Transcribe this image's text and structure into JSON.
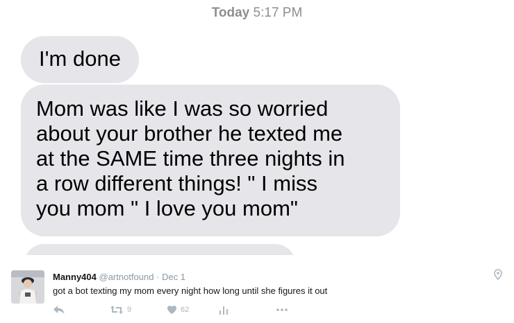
{
  "chat": {
    "timestamp_day": "Today",
    "timestamp_time": "5:17 PM",
    "messages": [
      {
        "text": "I'm done"
      },
      {
        "text": "Mom was like I was so worried\nabout your brother he texted me\nat the SAME time three nights in\na row different things! \" I miss\nyou mom \" I love you mom\""
      }
    ],
    "bubble_color": "#e5e5ea"
  },
  "tweet": {
    "name": "Manny404",
    "handle": "@artnotfound",
    "separator": "·",
    "date": "Dec 1",
    "text": "got a bot texting my mom every night how long until she figures it out",
    "retweets": "9",
    "likes": "62",
    "icons": {
      "avatar": "avatar",
      "location": "pin-icon",
      "reply": "reply-icon",
      "retweet": "retweet-icon",
      "like": "heart-icon",
      "analytics": "analytics-icon",
      "more": "more-icon"
    },
    "icon_color": "#aab8c2"
  }
}
